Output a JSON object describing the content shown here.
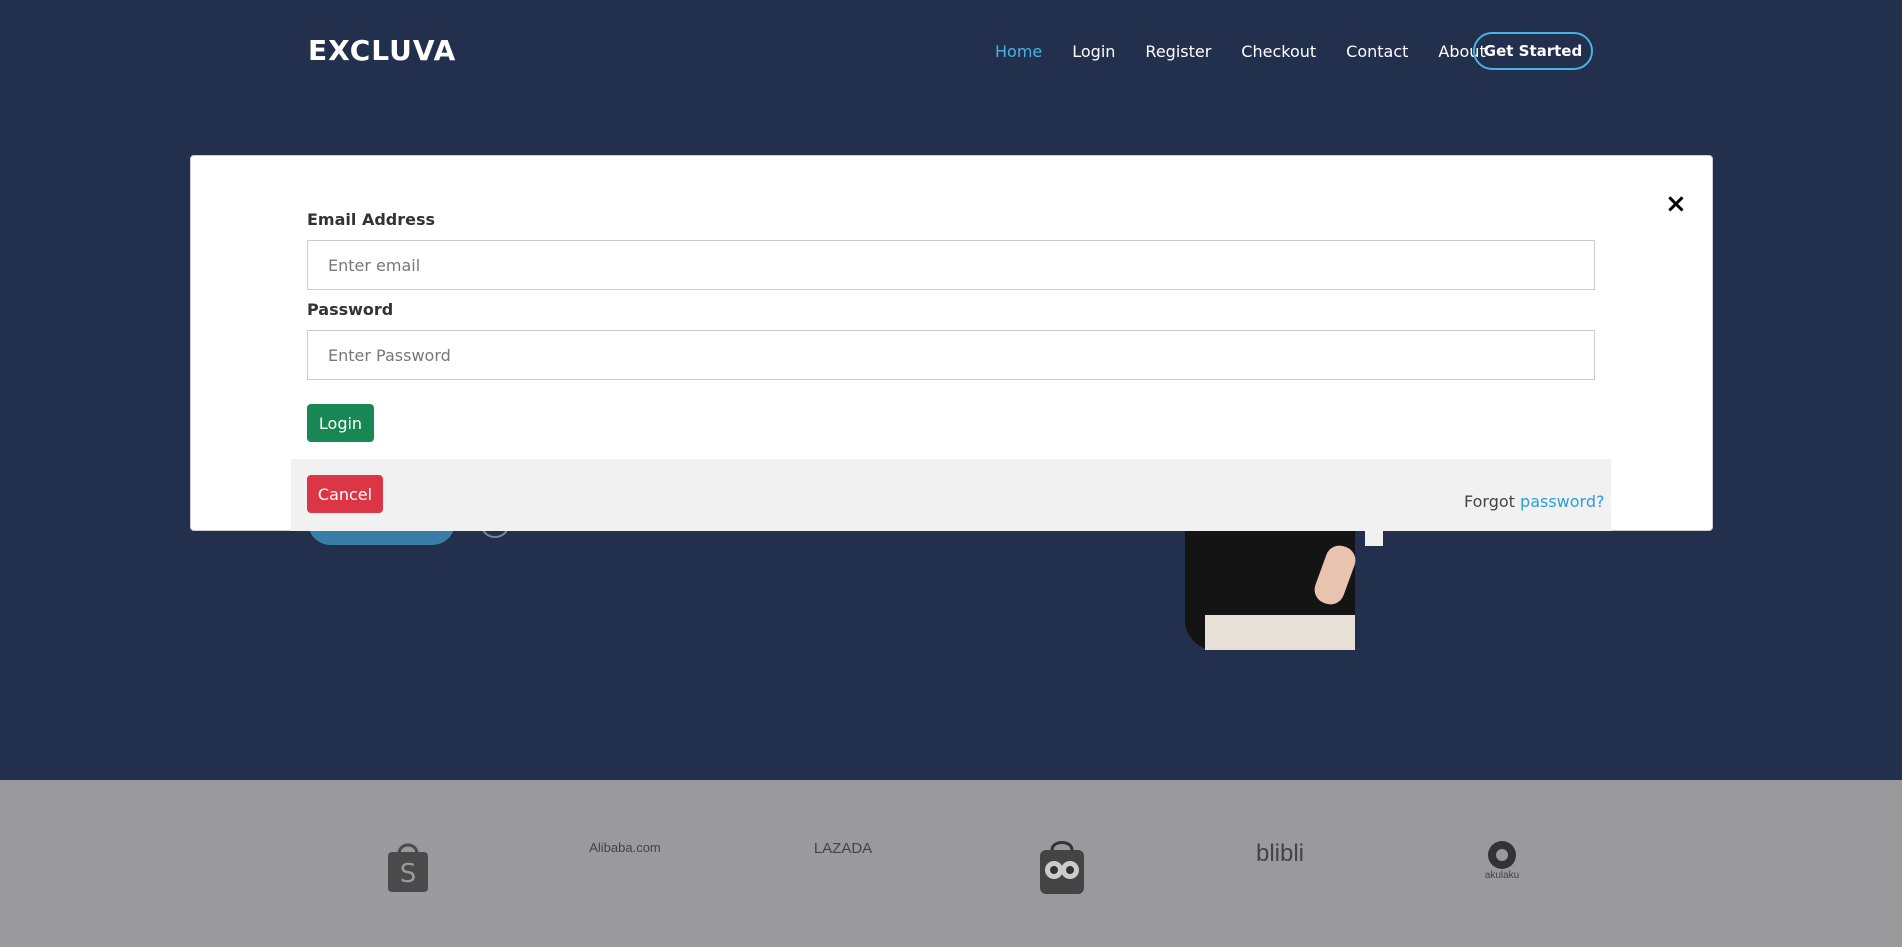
{
  "header": {
    "logo": "EXCLUVA",
    "nav": [
      "Home",
      "Login",
      "Register",
      "Checkout",
      "Contact",
      "About"
    ],
    "active_nav": "Home",
    "cta": "Get Started"
  },
  "modal": {
    "email_label": "Email Address",
    "email_placeholder": "Enter email",
    "password_label": "Password",
    "password_placeholder": "Enter Password",
    "login_label": "Login",
    "cancel_label": "Cancel",
    "forgot_prefix": "Forgot",
    "forgot_link": "password?",
    "close_glyph": "×"
  },
  "brands": [
    {
      "name": "shopee",
      "icon": "shopee-bag-icon"
    },
    {
      "name": "alibaba",
      "icon": "alibaba-icon",
      "text": "Alibaba.com"
    },
    {
      "name": "lazada",
      "icon": "lazada-icon",
      "text": "LAZADA"
    },
    {
      "name": "tokopedia",
      "icon": "tokopedia-owl-icon"
    },
    {
      "name": "blibli",
      "icon": "blibli-icon",
      "text": "blibli"
    },
    {
      "name": "akulaku",
      "icon": "akulaku-icon",
      "text": "akulaku"
    }
  ],
  "colors": {
    "hero_bg": "#22304d",
    "accent": "#47b2e4",
    "login_btn": "#198754",
    "cancel_btn": "#dc3545",
    "brand_band": "#9a9a9c"
  }
}
